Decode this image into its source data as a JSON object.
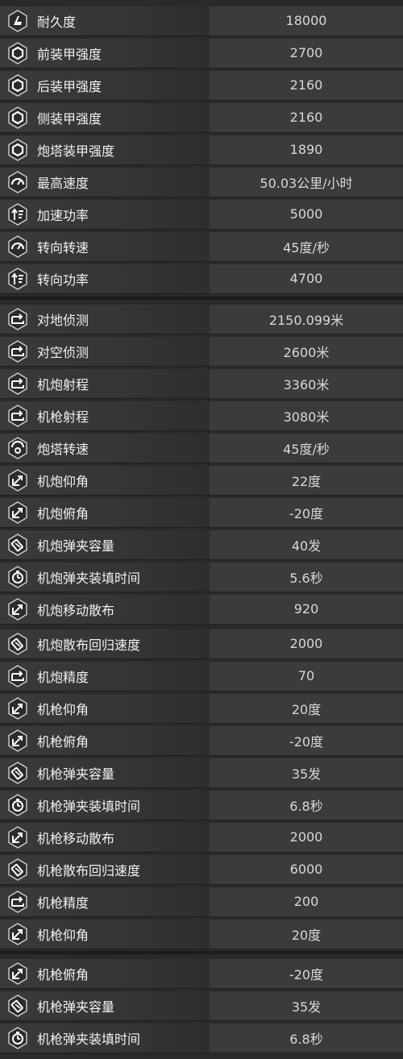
{
  "stats": [
    {
      "icon": "durability-icon",
      "label": "耐久度",
      "value": "18000"
    },
    {
      "icon": "armor-icon",
      "label": "前装甲强度",
      "value": "2700"
    },
    {
      "icon": "armor-icon",
      "label": "后装甲强度",
      "value": "2160"
    },
    {
      "icon": "armor-icon",
      "label": "侧装甲强度",
      "value": "2160"
    },
    {
      "icon": "armor-icon",
      "label": "炮塔装甲强度",
      "value": "1890"
    },
    {
      "icon": "speedometer-icon",
      "label": "最高速度",
      "value": "50.03公里/小时"
    },
    {
      "icon": "power-icon",
      "label": "加速功率",
      "value": "5000"
    },
    {
      "icon": "speedometer-icon",
      "label": "转向转速",
      "value": "45度/秒"
    },
    {
      "icon": "power-icon",
      "label": "转向功率",
      "value": "4700"
    },
    {
      "icon": "range-icon",
      "label": "对地侦测",
      "value": "2150.099米"
    },
    {
      "icon": "range-icon",
      "label": "对空侦测",
      "value": "2600米"
    },
    {
      "icon": "range-icon",
      "label": "机炮射程",
      "value": "3360米"
    },
    {
      "icon": "range-icon",
      "label": "机枪射程",
      "value": "3080米"
    },
    {
      "icon": "turret-speed-icon",
      "label": "炮塔转速",
      "value": "45度/秒"
    },
    {
      "icon": "elevation-icon",
      "label": "机炮仰角",
      "value": "22度"
    },
    {
      "icon": "elevation-icon",
      "label": "机炮俯角",
      "value": "-20度"
    },
    {
      "icon": "magazine-icon",
      "label": "机炮弹夹容量",
      "value": "40发"
    },
    {
      "icon": "reload-timer-icon",
      "label": "机炮弹夹装填时间",
      "value": "5.6秒"
    },
    {
      "icon": "elevation-icon",
      "label": "机炮移动散布",
      "value": "920"
    },
    {
      "icon": "magazine-icon",
      "label": "机炮散布回归速度",
      "value": "2000"
    },
    {
      "icon": "range-icon",
      "label": "机炮精度",
      "value": "70"
    },
    {
      "icon": "elevation-icon",
      "label": "机枪仰角",
      "value": "20度"
    },
    {
      "icon": "elevation-icon",
      "label": "机枪俯角",
      "value": "-20度"
    },
    {
      "icon": "magazine-icon",
      "label": "机枪弹夹容量",
      "value": "35发"
    },
    {
      "icon": "reload-timer-icon",
      "label": "机枪弹夹装填时间",
      "value": "6.8秒"
    },
    {
      "icon": "elevation-icon",
      "label": "机枪移动散布",
      "value": "2000"
    },
    {
      "icon": "magazine-icon",
      "label": "机枪散布回归速度",
      "value": "6000"
    },
    {
      "icon": "range-icon",
      "label": "机枪精度",
      "value": "200"
    },
    {
      "icon": "elevation-icon",
      "label": "机枪仰角",
      "value": "20度"
    },
    {
      "icon": "elevation-icon",
      "label": "机枪俯角",
      "value": "-20度"
    },
    {
      "icon": "magazine-icon",
      "label": "机枪弹夹容量",
      "value": "35发"
    },
    {
      "icon": "reload-timer-icon",
      "label": "机枪弹夹装填时间",
      "value": "6.8秒"
    }
  ]
}
